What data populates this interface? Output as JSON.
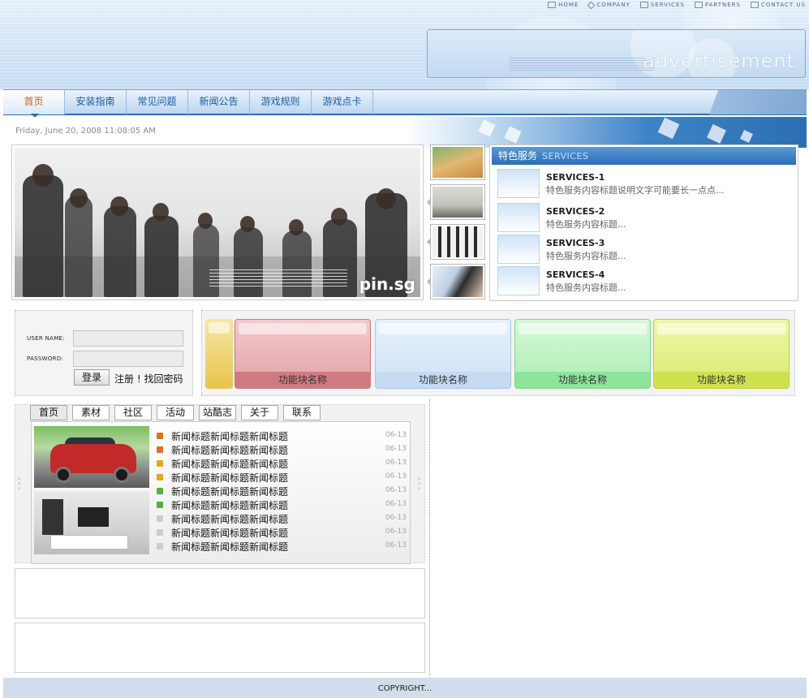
{
  "toplinks": [
    {
      "label": "HOME",
      "icon": "home-icon"
    },
    {
      "label": "COMPANY",
      "icon": "diamond-icon"
    },
    {
      "label": "SERVICES",
      "icon": "grid-icon"
    },
    {
      "label": "PARTNERS",
      "icon": "partners-icon"
    },
    {
      "label": "CONTACT US",
      "icon": "mail-icon"
    }
  ],
  "ad": {
    "text": "advertisement"
  },
  "nav": [
    {
      "label": "首页",
      "active": true
    },
    {
      "label": "安装指南"
    },
    {
      "label": "常见问题"
    },
    {
      "label": "新闻公告"
    },
    {
      "label": "游戏规则"
    },
    {
      "label": "游戏点卡"
    }
  ],
  "date": "Friday, June 20, 2008 11:08:05 AM",
  "hero": {
    "logo": "pin.sg"
  },
  "services": {
    "title_cn": "特色服务",
    "title_en": "SERVICES",
    "items": [
      {
        "title": "SERVICES-1",
        "desc": "特色服务内容标题说明文字可能要长一点点..."
      },
      {
        "title": "SERVICES-2",
        "desc": "特色服务内容标题..."
      },
      {
        "title": "SERVICES-3",
        "desc": "特色服务内容标题..."
      },
      {
        "title": "SERVICES-4",
        "desc": "特色服务内容标题..."
      }
    ]
  },
  "login": {
    "username_label": "USER NAME:",
    "password_label": "PASSWORD:",
    "username_value": "",
    "password_value": "",
    "submit_label": "登录",
    "links": "注册 ! 找回密码"
  },
  "features": [
    {
      "label": "功能块名称",
      "color": "#d07a82"
    },
    {
      "label": "功能块名称",
      "color": "#c4dbf2"
    },
    {
      "label": "功能块名称",
      "color": "#8fe49b"
    },
    {
      "label": "功能块名称",
      "color": "#cfe14e"
    }
  ],
  "tabs": [
    "首页",
    "素材",
    "社区",
    "活动",
    "站酷志",
    "关于",
    "联系"
  ],
  "news": [
    {
      "title": "新闻标题新闻标题新闻标题",
      "date": "06-13",
      "color": "#e0701f"
    },
    {
      "title": "新闻标题新闻标题新闻标题",
      "date": "06-13",
      "color": "#e0701f"
    },
    {
      "title": "新闻标题新闻标题新闻标题",
      "date": "06-13",
      "color": "#e6a91c"
    },
    {
      "title": "新闻标题新闻标题新闻标题",
      "date": "06-13",
      "color": "#e6a91c"
    },
    {
      "title": "新闻标题新闻标题新闻标题",
      "date": "06-13",
      "color": "#5aae3c"
    },
    {
      "title": "新闻标题新闻标题新闻标题",
      "date": "06-13",
      "color": "#5aae3c"
    },
    {
      "title": "新闻标题新闻标题新闻标题",
      "date": "06-13",
      "color": "#cccccc"
    },
    {
      "title": "新闻标题新闻标题新闻标题",
      "date": "06-13",
      "color": "#cccccc"
    },
    {
      "title": "新闻标题新闻标题新闻标题",
      "date": "06-13",
      "color": "#cccccc"
    }
  ],
  "footer": "COPYRIGHT..."
}
